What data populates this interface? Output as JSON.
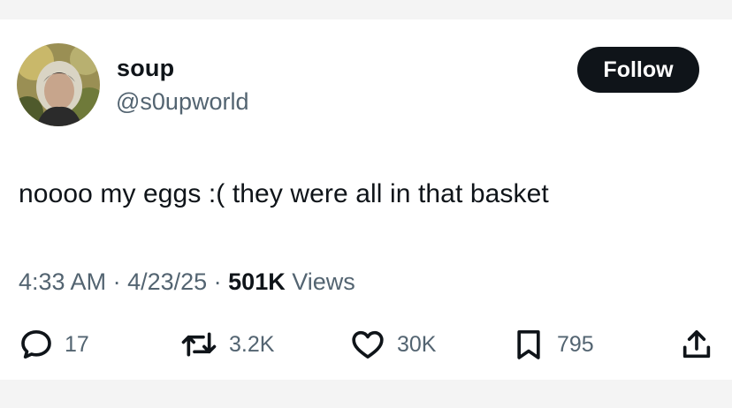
{
  "user": {
    "display_name": "soup",
    "handle": "@s0upworld"
  },
  "follow_label": "Follow",
  "tweet": {
    "text": "noooo my eggs :( they were all in that basket",
    "time": "4:33 AM",
    "date": "4/23/25",
    "views_count": "501K",
    "views_label": "Views"
  },
  "actions": {
    "replies": "17",
    "reposts": "3.2K",
    "likes": "30K",
    "bookmarks": "795"
  }
}
